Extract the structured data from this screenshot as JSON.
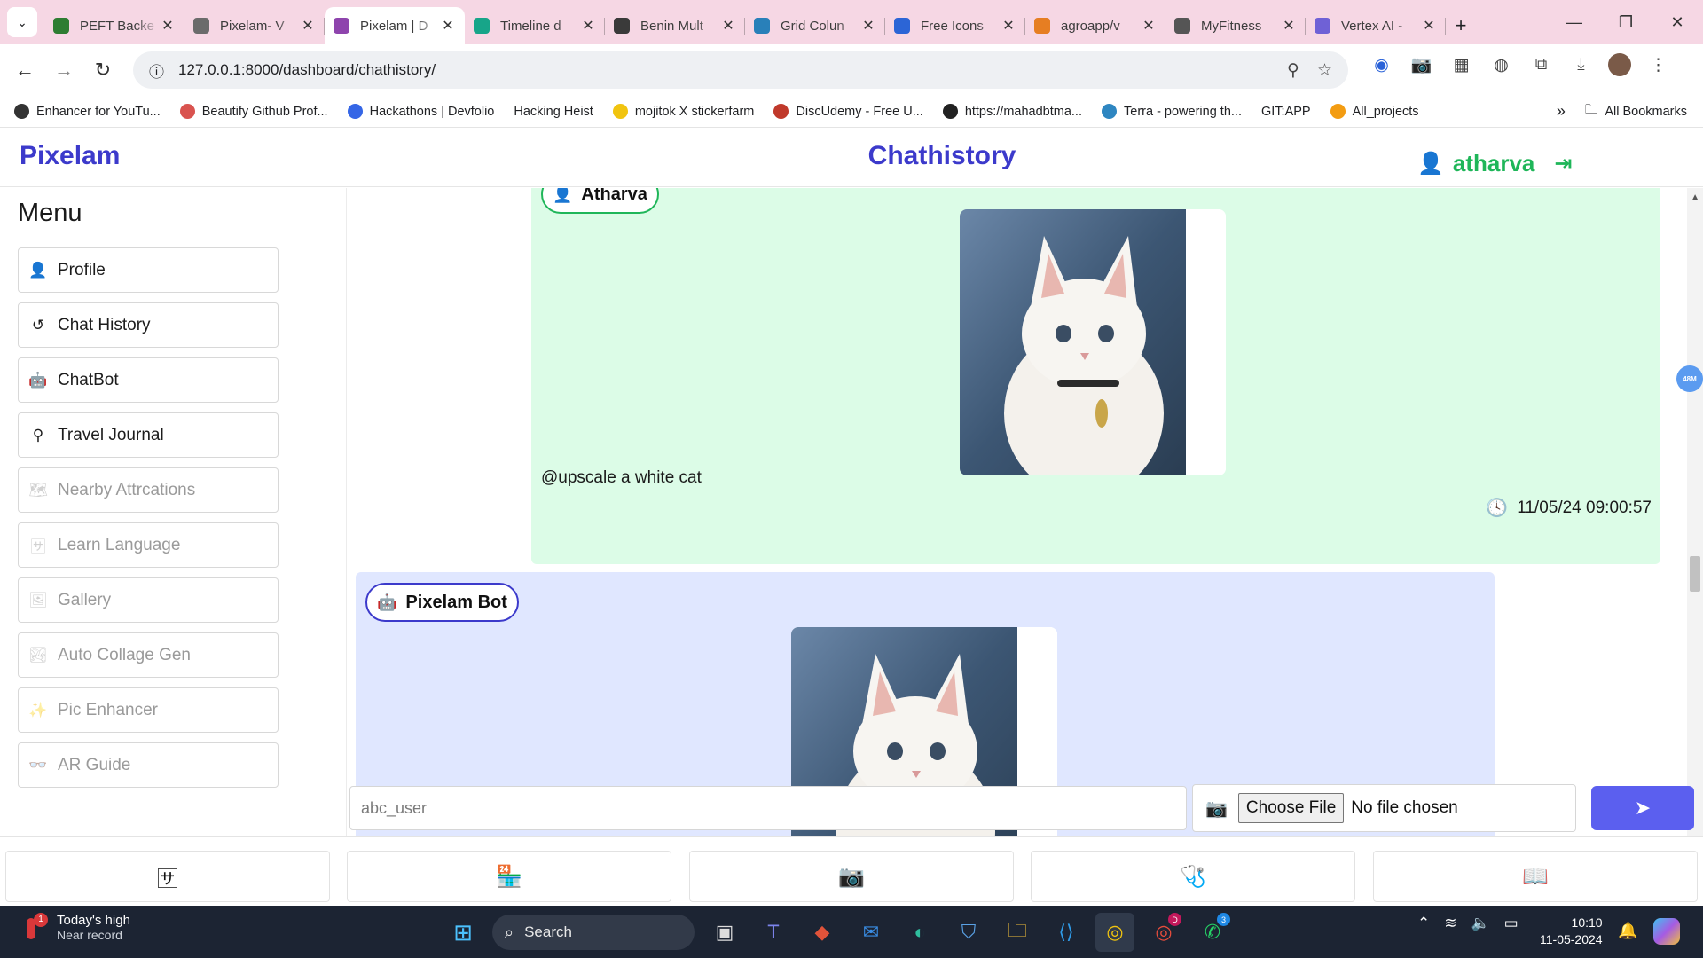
{
  "browser": {
    "tabs": [
      {
        "title": "PEFT Backe",
        "color": "#2e7d32",
        "active": false
      },
      {
        "title": "Pixelam- V",
        "color": "#6b6b6b",
        "active": false
      },
      {
        "title": "Pixelam | D",
        "color": "#8e44ad",
        "active": true
      },
      {
        "title": "Timeline d",
        "color": "#17a589",
        "active": false
      },
      {
        "title": "Benin Mult",
        "color": "#3a3a3a",
        "active": false
      },
      {
        "title": "Grid Colun",
        "color": "#2980b9",
        "active": false
      },
      {
        "title": "Free Icons",
        "color": "#2c65d6",
        "active": false
      },
      {
        "title": "agroapp/v",
        "color": "#e67e22",
        "active": false
      },
      {
        "title": "MyFitness",
        "color": "#555555",
        "active": false
      },
      {
        "title": "Vertex AI -",
        "color": "#6f61d6",
        "active": false
      }
    ],
    "url": "127.0.0.1:8000/dashboard/chathistory/",
    "bookmarks": [
      {
        "label": "Enhancer for YouTu...",
        "color": "#333333"
      },
      {
        "label": "Beautify Github Prof...",
        "color": "#d9534f"
      },
      {
        "label": "Hackathons | Devfolio",
        "color": "#3566e6"
      },
      {
        "label": "Hacking Heist",
        "color": ""
      },
      {
        "label": "mojitok X stickerfarm",
        "color": "#f1c40f"
      },
      {
        "label": "DiscUdemy - Free U...",
        "color": "#c0392b"
      },
      {
        "label": "https://mahadbtma...",
        "color": "#222222"
      },
      {
        "label": "Terra - powering th...",
        "color": "#2e86c1"
      },
      {
        "label": "GIT:APP",
        "color": ""
      },
      {
        "label": "All_projects",
        "color": "#f39c12"
      }
    ],
    "all_bookmarks": "All Bookmarks"
  },
  "app": {
    "brand": "Pixelam",
    "page_title": "Chathistory",
    "username": "atharva",
    "accent": "#3c3acb",
    "user_color": "#1fb659"
  },
  "sidebar": {
    "title": "Menu",
    "items": [
      {
        "label": "Profile",
        "icon": "user-icon",
        "glyph": "👤",
        "enabled": true
      },
      {
        "label": "Chat History",
        "icon": "history-icon",
        "glyph": "↺",
        "enabled": true
      },
      {
        "label": "ChatBot",
        "icon": "robot-icon",
        "glyph": "🤖",
        "enabled": true
      },
      {
        "label": "Travel Journal",
        "icon": "route-icon",
        "glyph": "⚲",
        "enabled": true
      },
      {
        "label": "Nearby Attrcations",
        "icon": "map-icon",
        "glyph": "🗺",
        "enabled": false
      },
      {
        "label": "Learn Language",
        "icon": "language-icon",
        "glyph": "🈂",
        "enabled": false
      },
      {
        "label": "Gallery",
        "icon": "images-icon",
        "glyph": "🖼",
        "enabled": false
      },
      {
        "label": "Auto Collage Gen",
        "icon": "image-icon",
        "glyph": "🏞",
        "enabled": false
      },
      {
        "label": "Pic Enhancer",
        "icon": "magic-wand-icon",
        "glyph": "✨",
        "enabled": false
      },
      {
        "label": "AR Guide",
        "icon": "vr-cardboard-icon",
        "glyph": "👓",
        "enabled": false
      }
    ]
  },
  "chat": {
    "user_message": {
      "sender": "Atharva",
      "text": "@upscale a white cat",
      "timestamp": "11/05/24 09:00:57",
      "bg": "#dcfce7"
    },
    "bot_message": {
      "sender": "Pixelam Bot",
      "bg": "#e0e7ff"
    }
  },
  "composer": {
    "input_value": "abc_user",
    "choose_file": "Choose File",
    "no_file": "No file chosen"
  },
  "bottom_nav": [
    {
      "icon": "language-icon",
      "glyph": "🈂"
    },
    {
      "icon": "store-icon",
      "glyph": "🏪"
    },
    {
      "icon": "camera-icon",
      "glyph": "📷"
    },
    {
      "icon": "first-aid-icon",
      "glyph": "🩺"
    },
    {
      "icon": "book-icon",
      "glyph": "📖"
    }
  ],
  "taskbar": {
    "weather_title": "Today's high",
    "weather_sub": "Near record",
    "weather_badge": "1",
    "search": "Search",
    "time": "10:10",
    "date": "11-05-2024",
    "whatsapp_badge": "3",
    "chrome_badge": "D"
  },
  "page_badge": "48M"
}
